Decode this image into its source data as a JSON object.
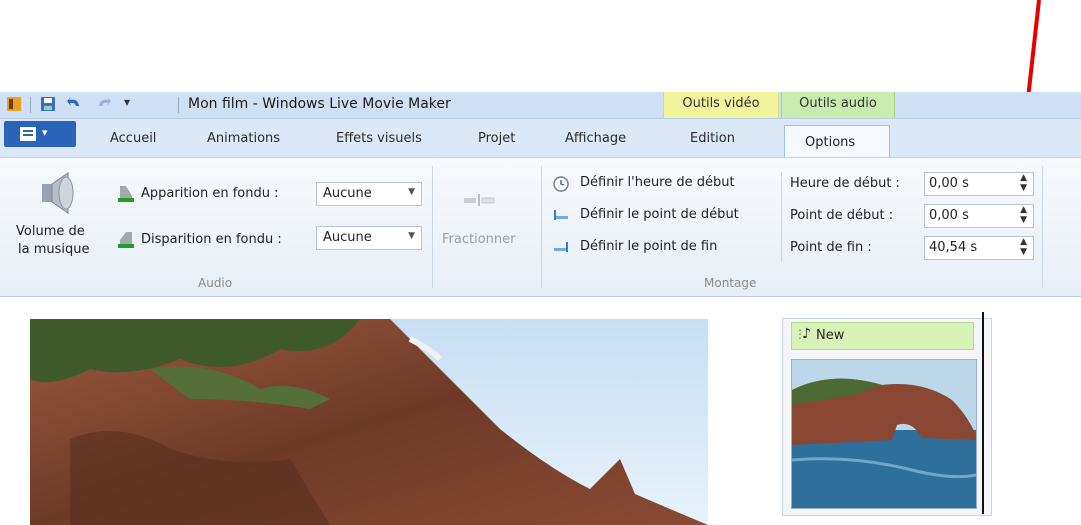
{
  "window": {
    "title": "Mon film - Windows Live Movie Maker"
  },
  "context_tabs": {
    "video_tools": "Outils vidéo",
    "audio_tools": "Outils audio"
  },
  "tabs": [
    "Accueil",
    "Animations",
    "Effets visuels",
    "Projet",
    "Affichage",
    "Edition",
    "Options"
  ],
  "audio": {
    "music_volume_line1": "Volume de",
    "music_volume_line2": "la musique",
    "fade_in_label": "Apparition en fondu :",
    "fade_in_value": "Aucune",
    "fade_out_label": "Disparition en fondu :",
    "fade_out_value": "Aucune",
    "group_label": "Audio"
  },
  "split": {
    "label": "Fractionner"
  },
  "editing": {
    "set_start_time": "Définir l'heure de début",
    "set_start_point": "Définir le point de début",
    "set_end_point": "Définir le point de fin",
    "start_time_label": "Heure de début :",
    "start_time_value": "0,00 s",
    "start_point_label": "Point de début :",
    "start_point_value": "0,00 s",
    "end_point_label": "Point de fin :",
    "end_point_value": "40,54 s",
    "group_label": "Montage"
  },
  "storyboard": {
    "audio_clip_name": "New"
  },
  "colors": {
    "annotation_arrow": "#e60000",
    "app_menu": "#2a64b8",
    "video_tools": "#f1f49c",
    "audio_tools": "#c8ebb0"
  }
}
